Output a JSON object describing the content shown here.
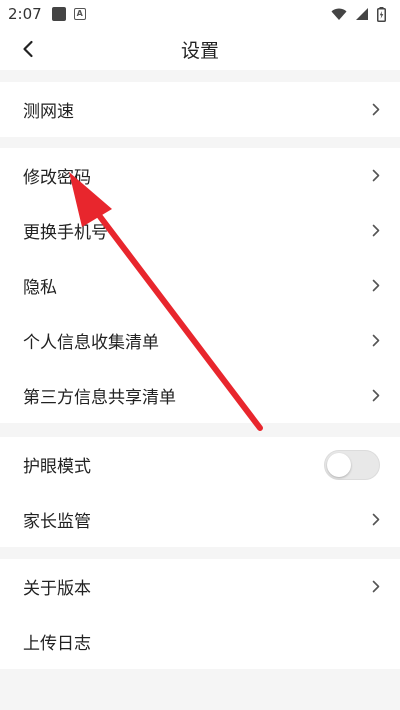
{
  "status_bar": {
    "time": "2:07",
    "notification_icon": "square-icon",
    "app_icon": "a-box-icon",
    "icons": [
      "wifi-icon",
      "signal-icon",
      "battery-icon"
    ]
  },
  "header": {
    "title": "设置",
    "back_icon": "chevron-left-icon"
  },
  "groups": [
    {
      "items": [
        {
          "label": "测网速",
          "control": "chevron"
        }
      ]
    },
    {
      "items": [
        {
          "label": "修改密码",
          "control": "chevron"
        },
        {
          "label": "更换手机号",
          "control": "chevron"
        },
        {
          "label": "隐私",
          "control": "chevron"
        },
        {
          "label": "个人信息收集清单",
          "control": "chevron"
        },
        {
          "label": "第三方信息共享清单",
          "control": "chevron"
        }
      ]
    },
    {
      "items": [
        {
          "label": "护眼模式",
          "control": "toggle",
          "on": false
        },
        {
          "label": "家长监管",
          "control": "chevron"
        }
      ]
    },
    {
      "items": [
        {
          "label": "关于版本",
          "control": "chevron"
        },
        {
          "label": "上传日志",
          "control": "none"
        }
      ]
    }
  ],
  "annotation": {
    "type": "arrow",
    "color": "#e8262d",
    "points_to": "修改密码"
  },
  "colors": {
    "background": "#f5f5f5",
    "card": "#ffffff",
    "chevron": "#555555"
  }
}
